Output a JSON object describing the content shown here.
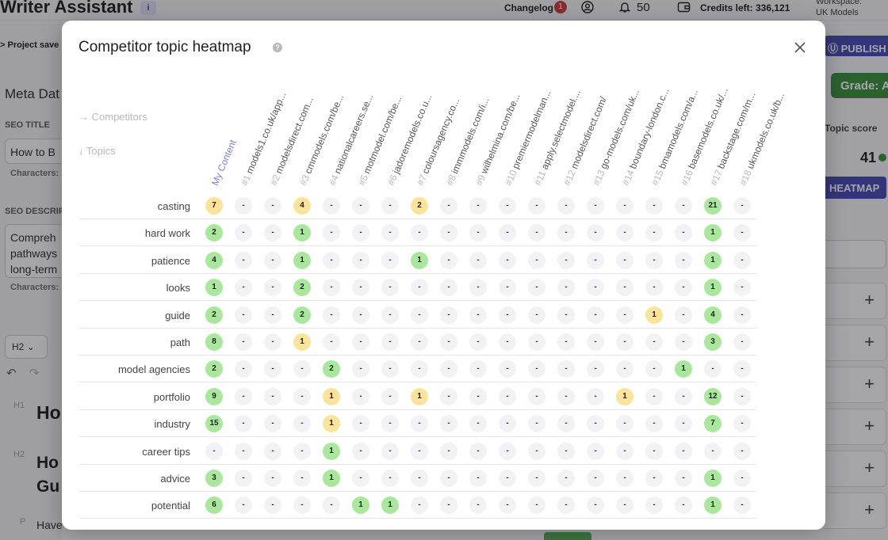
{
  "app": {
    "title": "Writer Assistant",
    "info_icon": "info-icon",
    "changelog_label": "Changelog",
    "changelog_count": "1",
    "notifications_count": "50",
    "credits_label": "Credits left: 336,121",
    "workspace_label": "Workspace:",
    "workspace_value": "UK Models"
  },
  "left": {
    "project_saved": "Project save",
    "meta_title": "Meta Dat",
    "seo_title_label": "SEO TITLE",
    "seo_title_value": "How to B",
    "characters_label": "Characters:",
    "seo_desc_label": "SEO DESCRIP",
    "seo_desc_lines": [
      "Compreh",
      "pathways",
      "long-term"
    ],
    "heading_select": "H2",
    "h1_tag": "H1",
    "h1_text": "Ho",
    "h2_tag": "H2",
    "h2_line1": "Ho",
    "h2_line2": "Gu",
    "p_tag": "P",
    "p_text": "Have"
  },
  "right": {
    "publish_label": "PUBLISH",
    "grade_label": "Grade: A",
    "topic_score_label": "Topic score",
    "topic_score_value": "41",
    "heatmap_label": "HEATMAP"
  },
  "modal": {
    "title": "Competitor topic heatmap",
    "help_icon": "help-icon",
    "close_icon": "close-icon",
    "competitors_label": "Competitors",
    "topics_label": "Topics",
    "columns": [
      {
        "num": "",
        "name": "My Content"
      },
      {
        "num": "#1",
        "name": "models1.co.uk/app..."
      },
      {
        "num": "#2",
        "name": "modelsdirect.com..."
      },
      {
        "num": "#3",
        "name": "cmmodels.com/be..."
      },
      {
        "num": "#4",
        "name": "nationalcareers.se..."
      },
      {
        "num": "#5",
        "name": "motmodel.com/be..."
      },
      {
        "num": "#6",
        "name": "jadoremodels.co.u..."
      },
      {
        "num": "#7",
        "name": "coloursagency.co..."
      },
      {
        "num": "#8",
        "name": "immmodels.com/i..."
      },
      {
        "num": "#9",
        "name": "wilhelmina.com/be..."
      },
      {
        "num": "#10",
        "name": "premiermodelman..."
      },
      {
        "num": "#11",
        "name": "apply.selectmodel...."
      },
      {
        "num": "#12",
        "name": "modelsdirect.com/"
      },
      {
        "num": "#13",
        "name": "go-models.com/uk..."
      },
      {
        "num": "#14",
        "name": "boundary-london.c..."
      },
      {
        "num": "#15",
        "name": "bmamodels.com/a..."
      },
      {
        "num": "#16",
        "name": "basemodels.co.uk/..."
      },
      {
        "num": "#17",
        "name": "backstage.com/m..."
      },
      {
        "num": "#18",
        "name": "ukmodels.co.uk/b..."
      }
    ],
    "rows": [
      {
        "topic": "casting",
        "cells": [
          "7",
          "-",
          "-",
          "4",
          "-",
          "-",
          "-",
          "2",
          "-",
          "-",
          "-",
          "-",
          "-",
          "-",
          "-",
          "-",
          "-",
          "21",
          "-"
        ],
        "colors": [
          "y",
          "n",
          "n",
          "y",
          "n",
          "n",
          "n",
          "y",
          "n",
          "n",
          "n",
          "n",
          "n",
          "n",
          "n",
          "n",
          "n",
          "g",
          "n"
        ]
      },
      {
        "topic": "hard work",
        "cells": [
          "2",
          "-",
          "-",
          "1",
          "-",
          "-",
          "-",
          "-",
          "-",
          "-",
          "-",
          "-",
          "-",
          "-",
          "-",
          "-",
          "-",
          "1",
          "-"
        ],
        "colors": [
          "g",
          "n",
          "n",
          "g",
          "n",
          "n",
          "n",
          "n",
          "n",
          "n",
          "n",
          "n",
          "n",
          "n",
          "n",
          "n",
          "n",
          "g",
          "n"
        ]
      },
      {
        "topic": "patience",
        "cells": [
          "4",
          "-",
          "-",
          "1",
          "-",
          "-",
          "-",
          "1",
          "-",
          "-",
          "-",
          "-",
          "-",
          "-",
          "-",
          "-",
          "-",
          "1",
          "-"
        ],
        "colors": [
          "g",
          "n",
          "n",
          "g",
          "n",
          "n",
          "n",
          "g",
          "n",
          "n",
          "n",
          "n",
          "n",
          "n",
          "n",
          "n",
          "n",
          "g",
          "n"
        ]
      },
      {
        "topic": "looks",
        "cells": [
          "1",
          "-",
          "-",
          "2",
          "-",
          "-",
          "-",
          "-",
          "-",
          "-",
          "-",
          "-",
          "-",
          "-",
          "-",
          "-",
          "-",
          "1",
          "-"
        ],
        "colors": [
          "g",
          "n",
          "n",
          "g",
          "n",
          "n",
          "n",
          "n",
          "n",
          "n",
          "n",
          "n",
          "n",
          "n",
          "n",
          "n",
          "n",
          "g",
          "n"
        ]
      },
      {
        "topic": "guide",
        "cells": [
          "2",
          "-",
          "-",
          "2",
          "-",
          "-",
          "-",
          "-",
          "-",
          "-",
          "-",
          "-",
          "-",
          "-",
          "-",
          "1",
          "-",
          "4",
          "-"
        ],
        "colors": [
          "g",
          "n",
          "n",
          "g",
          "n",
          "n",
          "n",
          "n",
          "n",
          "n",
          "n",
          "n",
          "n",
          "n",
          "n",
          "y",
          "n",
          "g",
          "n"
        ]
      },
      {
        "topic": "path",
        "cells": [
          "8",
          "-",
          "-",
          "1",
          "-",
          "-",
          "-",
          "-",
          "-",
          "-",
          "-",
          "-",
          "-",
          "-",
          "-",
          "-",
          "-",
          "3",
          "-"
        ],
        "colors": [
          "g",
          "n",
          "n",
          "y",
          "n",
          "n",
          "n",
          "n",
          "n",
          "n",
          "n",
          "n",
          "n",
          "n",
          "n",
          "n",
          "n",
          "g",
          "n"
        ]
      },
      {
        "topic": "model agencies",
        "cells": [
          "2",
          "-",
          "-",
          "-",
          "2",
          "-",
          "-",
          "-",
          "-",
          "-",
          "-",
          "-",
          "-",
          "-",
          "-",
          "-",
          "1",
          "-",
          "-"
        ],
        "colors": [
          "g",
          "n",
          "n",
          "n",
          "g",
          "n",
          "n",
          "n",
          "n",
          "n",
          "n",
          "n",
          "n",
          "n",
          "n",
          "n",
          "g",
          "n",
          "n"
        ]
      },
      {
        "topic": "portfolio",
        "cells": [
          "9",
          "-",
          "-",
          "-",
          "1",
          "-",
          "-",
          "1",
          "-",
          "-",
          "-",
          "-",
          "-",
          "-",
          "1",
          "-",
          "-",
          "12",
          "-"
        ],
        "colors": [
          "g",
          "n",
          "n",
          "n",
          "y",
          "n",
          "n",
          "y",
          "n",
          "n",
          "n",
          "n",
          "n",
          "n",
          "y",
          "n",
          "n",
          "g",
          "n"
        ]
      },
      {
        "topic": "industry",
        "cells": [
          "15",
          "-",
          "-",
          "-",
          "1",
          "-",
          "-",
          "-",
          "-",
          "-",
          "-",
          "-",
          "-",
          "-",
          "-",
          "-",
          "-",
          "7",
          "-"
        ],
        "colors": [
          "g",
          "n",
          "n",
          "n",
          "y",
          "n",
          "n",
          "n",
          "n",
          "n",
          "n",
          "n",
          "n",
          "n",
          "n",
          "n",
          "n",
          "g",
          "n"
        ]
      },
      {
        "topic": "career tips",
        "cells": [
          "-",
          "-",
          "-",
          "-",
          "1",
          "-",
          "-",
          "-",
          "-",
          "-",
          "-",
          "-",
          "-",
          "-",
          "-",
          "-",
          "-",
          "-",
          "-"
        ],
        "colors": [
          "n",
          "n",
          "n",
          "n",
          "g",
          "n",
          "n",
          "n",
          "n",
          "n",
          "n",
          "n",
          "n",
          "n",
          "n",
          "n",
          "n",
          "n",
          "n"
        ]
      },
      {
        "topic": "advice",
        "cells": [
          "3",
          "-",
          "-",
          "-",
          "1",
          "-",
          "-",
          "-",
          "-",
          "-",
          "-",
          "-",
          "-",
          "-",
          "-",
          "-",
          "-",
          "1",
          "-"
        ],
        "colors": [
          "g",
          "n",
          "n",
          "n",
          "g",
          "n",
          "n",
          "n",
          "n",
          "n",
          "n",
          "n",
          "n",
          "n",
          "n",
          "n",
          "n",
          "g",
          "n"
        ]
      },
      {
        "topic": "potential",
        "cells": [
          "6",
          "-",
          "-",
          "-",
          "-",
          "1",
          "1",
          "-",
          "-",
          "-",
          "-",
          "-",
          "-",
          "-",
          "-",
          "-",
          "-",
          "1",
          "-"
        ],
        "colors": [
          "g",
          "n",
          "n",
          "n",
          "n",
          "g",
          "g",
          "n",
          "n",
          "n",
          "n",
          "n",
          "n",
          "n",
          "n",
          "n",
          "n",
          "g",
          "n"
        ]
      }
    ]
  }
}
